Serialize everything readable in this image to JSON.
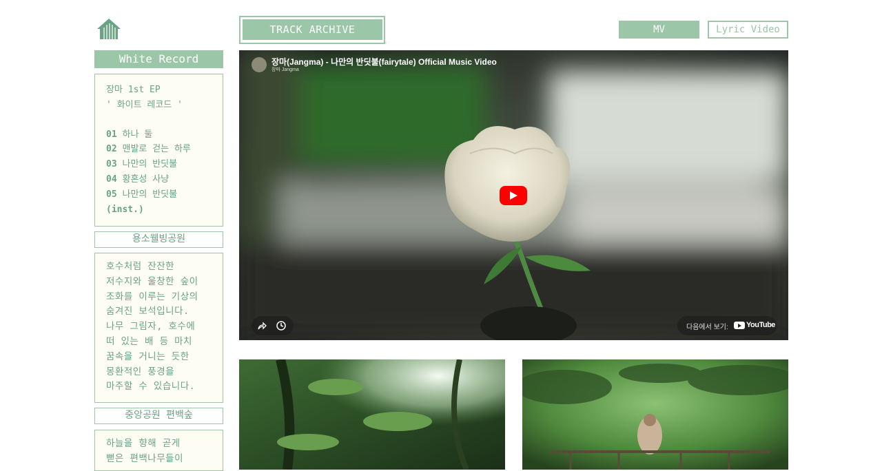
{
  "header": {
    "archive_label": "TRACK ARCHIVE",
    "mv_label": "MV",
    "lyric_label": "Lyric Video"
  },
  "sidebar": {
    "title": "White Record",
    "album_line1": "장마 1st EP",
    "album_line2": "' 화이트 레코드 '",
    "tracks": [
      {
        "num": "01",
        "title": "하나 둘"
      },
      {
        "num": "02",
        "title": "맨발로 걷는 하루"
      },
      {
        "num": "03",
        "title": "나만의 반딧불"
      },
      {
        "num": "04",
        "title": "황혼성 사냥"
      },
      {
        "num": "05",
        "title": "나만의 반딧불"
      }
    ],
    "track5_suffix": "(inst.)",
    "place1_title": "용소웰빙공원",
    "place1_lines": [
      "호수처럼 잔잔한",
      "저수지와 울창한 숲이",
      "조화를 이루는 기상의",
      "숨겨진 보석입니다.",
      "나무 그림자, 호수에",
      "떠 있는 배 등 마치",
      "꿈속을 거니는 듯한",
      "몽환적인 풍경을",
      "마주할 수 있습니다."
    ],
    "place2_title": "중앙공원 편백숲",
    "place2_lines": [
      "하늘을 향해 곧게",
      "뻗은 편백나무들이"
    ]
  },
  "video": {
    "title": "장마(Jangma) - 나만의 반딧불(fairytale) Official Music Video",
    "channel": "장마 Jangma",
    "watch_on": "다음에서 보기:",
    "youtube": "YouTube"
  }
}
